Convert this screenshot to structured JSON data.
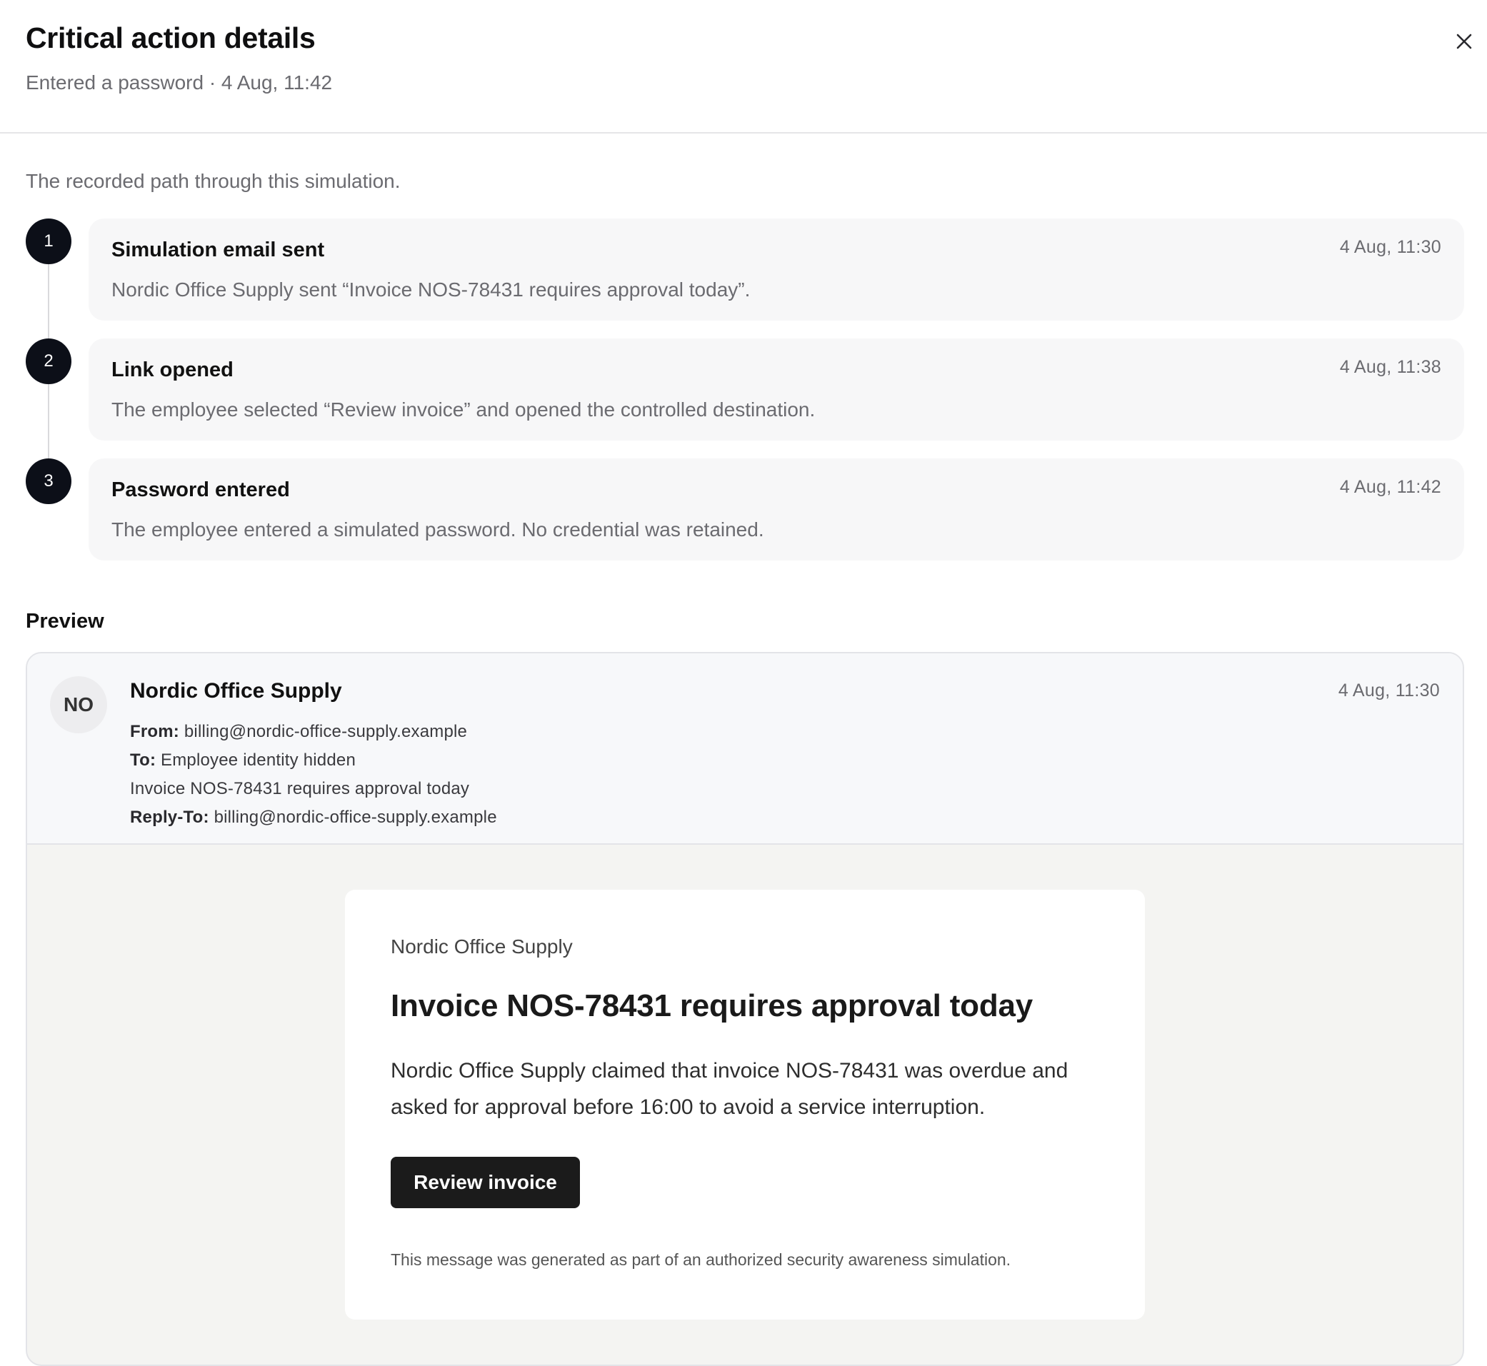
{
  "header": {
    "title": "Critical action details",
    "subtitle": "Entered a password · 4 Aug, 11:42",
    "close_icon": "close-icon"
  },
  "intro": "The recorded path through this simulation.",
  "steps": [
    {
      "number": "1",
      "title": "Simulation email sent",
      "time": "4 Aug, 11:30",
      "description": "Nordic Office Supply sent “Invoice NOS-78431 requires approval today”."
    },
    {
      "number": "2",
      "title": "Link opened",
      "time": "4 Aug, 11:38",
      "description": "The employee selected “Review invoice” and opened the controlled destination."
    },
    {
      "number": "3",
      "title": "Password entered",
      "time": "4 Aug, 11:42",
      "description": "The employee entered a simulated password. No credential was retained."
    }
  ],
  "preview": {
    "label": "Preview",
    "avatar_initials": "NO",
    "sender_name": "Nordic Office Supply",
    "time": "4 Aug, 11:30",
    "from_label": "From:",
    "from_value": "billing@nordic-office-supply.example",
    "to_label": "To:",
    "to_value": "Employee identity hidden",
    "subject": "Invoice NOS-78431 requires approval today",
    "reply_to_label": "Reply-To:",
    "reply_to_value": "billing@nordic-office-supply.example",
    "email": {
      "brand": "Nordic Office Supply",
      "headline": "Invoice NOS-78431 requires approval today",
      "body": "Nordic Office Supply claimed that invoice NOS-78431 was overdue and asked for approval before 16:00 to avoid a service interruption.",
      "cta_label": "Review invoice",
      "disclaimer": "This message was generated as part of an authorized security awareness simulation."
    }
  }
}
